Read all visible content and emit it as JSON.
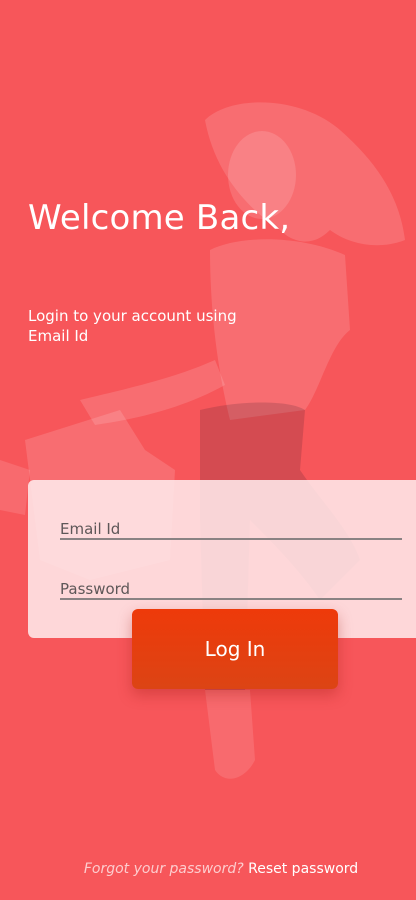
{
  "welcome": {
    "title": "Welcome Back,",
    "subtitle": "Login to your account using Email Id"
  },
  "form": {
    "email_label": "Email Id",
    "password_label": "Password",
    "login_label": "Log In"
  },
  "footer": {
    "forgot_text": "Forgot your password?",
    "reset_link": "Reset password"
  },
  "colors": {
    "background": "#f7565a",
    "button": "#ee3a0a",
    "card": "#ffecee"
  }
}
